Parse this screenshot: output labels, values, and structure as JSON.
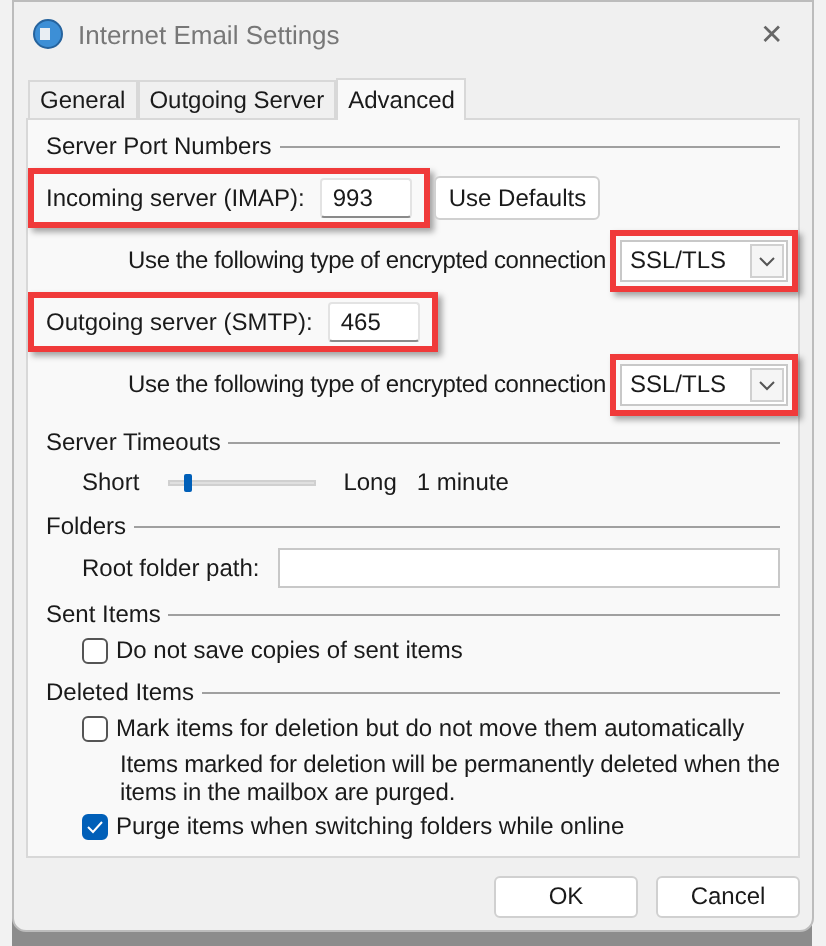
{
  "window": {
    "title": "Internet Email Settings",
    "close": "✕"
  },
  "tabs": [
    {
      "label": "General",
      "selected": false
    },
    {
      "label": "Outgoing Server",
      "selected": false
    },
    {
      "label": "Advanced",
      "selected": true
    }
  ],
  "server_ports": {
    "title": "Server Port Numbers",
    "incoming": {
      "label": "Incoming server (IMAP):",
      "value": "993",
      "highlighted": true
    },
    "use_defaults": "Use Defaults",
    "incoming_encryption": {
      "label": "Use the following type of encrypted connection",
      "value": "SSL/TLS",
      "highlighted": true
    },
    "outgoing": {
      "label": "Outgoing server (SMTP):",
      "value": "465",
      "highlighted": true
    },
    "outgoing_encryption": {
      "label": "Use the following type of encrypted connection",
      "value": "SSL/TLS",
      "highlighted": true
    }
  },
  "server_timeouts": {
    "title": "Server Timeouts",
    "short_label": "Short",
    "long_label": "Long",
    "level": 0.1,
    "reading": "1 minute"
  },
  "folders": {
    "title": "Folders",
    "root_label": "Root folder path:"
  },
  "sent_items": {
    "title": "Sent Items",
    "options": [
      {
        "label": "Do not save copies of sent items",
        "checked": false
      }
    ]
  },
  "deleted_items": {
    "title": "Deleted Items",
    "options": [
      {
        "label": "Mark items for deletion but do not move them automatically",
        "checked": false,
        "note": "Items marked for deletion will be permanently deleted when the items in the mailbox are purged."
      },
      {
        "label": "Purge items when switching folders while online",
        "checked": true
      }
    ]
  },
  "buttons": [
    "OK",
    "Cancel"
  ]
}
